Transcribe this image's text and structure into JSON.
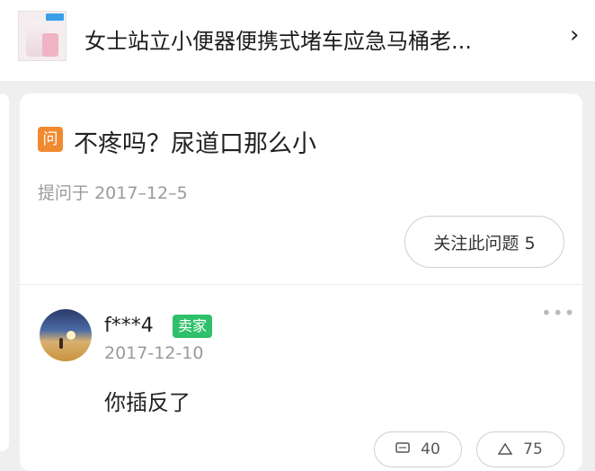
{
  "product": {
    "title": "女士站立小便器便携式堵车应急马桶老...",
    "chevron": "›"
  },
  "question": {
    "icon_label": "问",
    "text": "不疼吗？尿道口那么小",
    "asked_prefix": "提问于",
    "asked_date": "2017–12–5",
    "follow_label": "关注此问题 5"
  },
  "answer": {
    "username": "f***4",
    "badge": "卖家",
    "date": "2017-12-10",
    "text": "你插反了",
    "more": "•••",
    "comment_icon": "comment-icon",
    "comment_count": "40",
    "like_icon": "thumbs-up-icon",
    "like_count": "75"
  },
  "colors": {
    "question_icon": "#f08a30",
    "seller_badge": "#2ec06a"
  }
}
